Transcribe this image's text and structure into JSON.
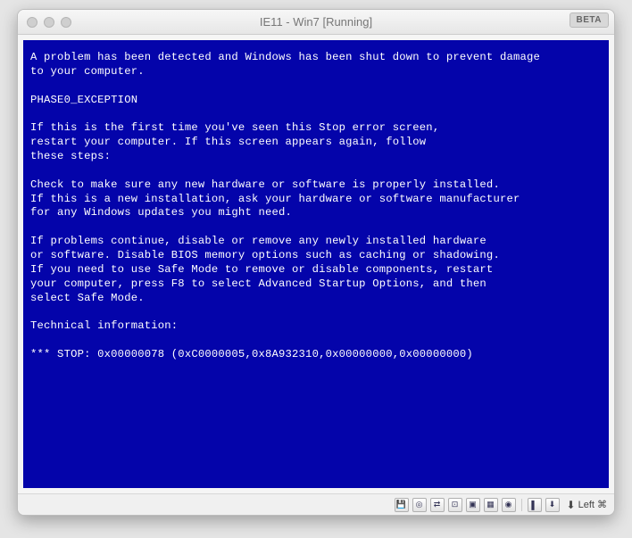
{
  "titlebar": {
    "title": "IE11 - Win7 [Running]",
    "beta_label": "BETA"
  },
  "bsod": {
    "lines": [
      "A problem has been detected and Windows has been shut down to prevent damage",
      "to your computer.",
      "",
      "PHASE0_EXCEPTION",
      "",
      "If this is the first time you've seen this Stop error screen,",
      "restart your computer. If this screen appears again, follow",
      "these steps:",
      "",
      "Check to make sure any new hardware or software is properly installed.",
      "If this is a new installation, ask your hardware or software manufacturer",
      "for any Windows updates you might need.",
      "",
      "If problems continue, disable or remove any newly installed hardware",
      "or software. Disable BIOS memory options such as caching or shadowing.",
      "If you need to use Safe Mode to remove or disable components, restart",
      "your computer, press F8 to select Advanced Startup Options, and then",
      "select Safe Mode.",
      "",
      "Technical information:",
      "",
      "*** STOP: 0x00000078 (0xC0000005,0x8A932310,0x00000000,0x00000000)"
    ]
  },
  "statusbar": {
    "hostkey_label": "Left ⌘",
    "icons": {
      "floppy": "💾",
      "discs": "◎",
      "network": "⇄",
      "usb": "⊡",
      "shared": "▣",
      "display": "▦",
      "rec": "◉",
      "mouse": "▌",
      "down": "⬇"
    }
  }
}
